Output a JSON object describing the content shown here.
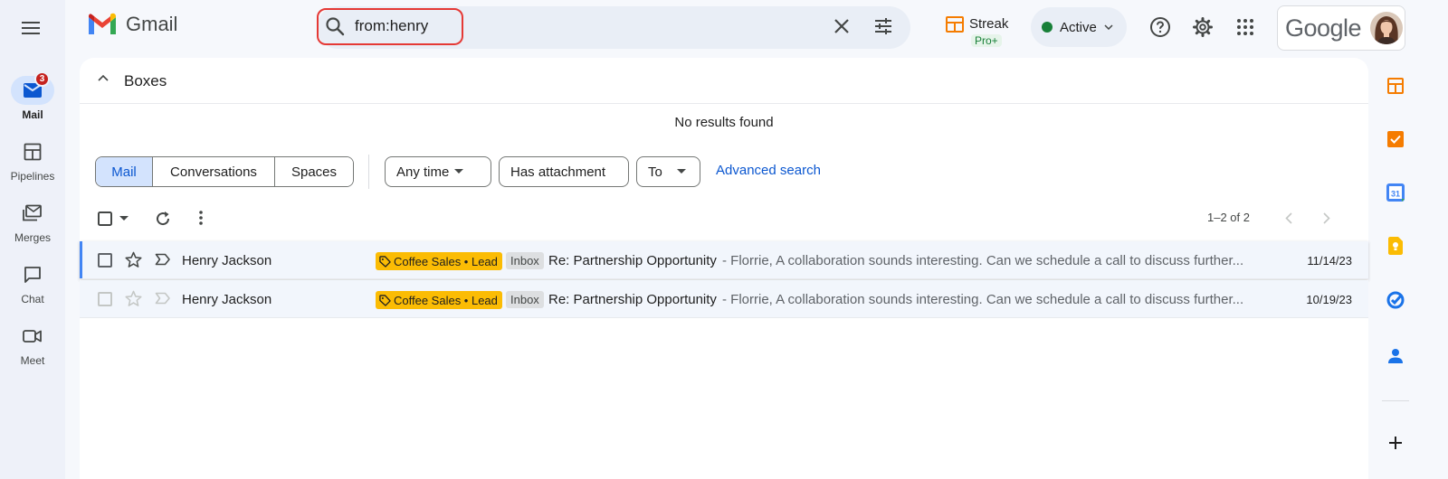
{
  "app": {
    "name": "Gmail"
  },
  "rail": {
    "items": [
      {
        "label": "Mail",
        "badge": "3",
        "icon": "mail-icon",
        "active": true
      },
      {
        "label": "Pipelines",
        "icon": "pipelines-icon"
      },
      {
        "label": "Merges",
        "icon": "merges-icon"
      },
      {
        "label": "Chat",
        "icon": "chat-icon"
      },
      {
        "label": "Meet",
        "icon": "meet-icon"
      }
    ]
  },
  "search": {
    "query": "from:henry"
  },
  "streak": {
    "name": "Streak",
    "plan": "Pro+"
  },
  "status": {
    "label": "Active",
    "color": "#188038"
  },
  "account": {
    "brand": "Google"
  },
  "boxes": {
    "label": "Boxes",
    "no_results": "No results found"
  },
  "filters": {
    "segments": [
      "Mail",
      "Conversations",
      "Spaces"
    ],
    "chips": [
      "Any time",
      "Has attachment",
      "To"
    ],
    "advanced": "Advanced search"
  },
  "list": {
    "pagination": "1–2 of 2",
    "rows": [
      {
        "sender": "Henry Jackson",
        "tag": "Coffee Sales • Lead",
        "folder": "Inbox",
        "subject": "Re: Partnership Opportunity",
        "snippet": " - Florrie, A collaboration sounds interesting. Can we schedule a call to discuss further...",
        "date": "11/14/23"
      },
      {
        "sender": "Henry Jackson",
        "tag": "Coffee Sales • Lead",
        "folder": "Inbox",
        "subject": "Re: Partnership Opportunity",
        "snippet": " - Florrie, A collaboration sounds interesting. Can we schedule a call to discuss further...",
        "date": "10/19/23"
      }
    ]
  },
  "colors": {
    "accent": "#0b57d0",
    "tag": "#fbbc04",
    "streak": "#f57c00",
    "badge": "#c5221f"
  }
}
